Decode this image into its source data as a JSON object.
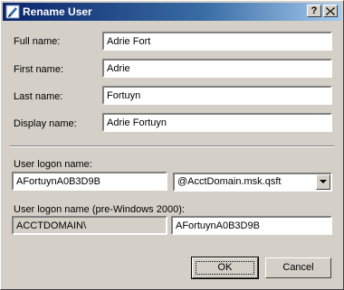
{
  "window": {
    "title": "Rename User",
    "help_button": "?",
    "close_button": "X"
  },
  "form": {
    "full_name": {
      "label": "Full name:",
      "value": "Adrie Fort"
    },
    "first_name": {
      "label": "First name:",
      "value": "Adrie"
    },
    "last_name": {
      "label": "Last name:",
      "value": "Fortuyn"
    },
    "display_name": {
      "label": "Display name:",
      "value": "Adrie Fortuyn"
    },
    "logon_name": {
      "label": "User logon name:",
      "value": "AFortuynA0B3D9B",
      "domain_suffix": "@AcctDomain.msk.qsft"
    },
    "pre2000_logon": {
      "label": "User logon name (pre-Windows 2000):",
      "domain": "ACCTDOMAIN\\",
      "value": "AFortuynA0B3D9B"
    }
  },
  "buttons": {
    "ok": "OK",
    "cancel": "Cancel"
  }
}
